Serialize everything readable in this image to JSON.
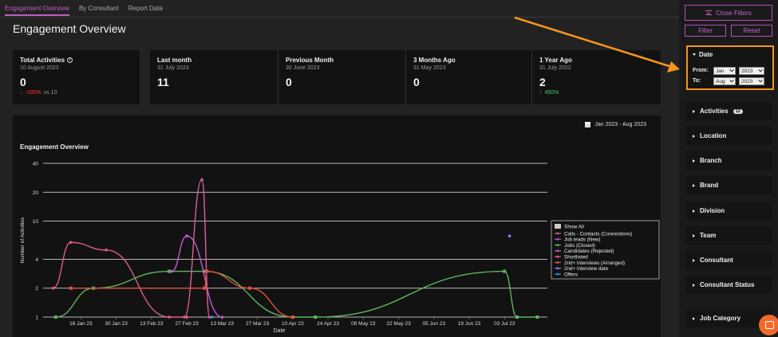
{
  "tabs": [
    {
      "label": "Engagement Overview",
      "active": true
    },
    {
      "label": "By Consultant",
      "active": false
    },
    {
      "label": "Report Data",
      "active": false
    }
  ],
  "page_title": "Engagement Overview",
  "kpis": {
    "total": {
      "label": "Total Activities",
      "date": "10 August 2023",
      "value": "0",
      "change": "-100%",
      "vs": "vs 10"
    },
    "last_month": {
      "label": "Last month",
      "date": "31 July 2023",
      "value": "11"
    },
    "previous_month": {
      "label": "Previous Month",
      "date": "30 June 2023",
      "value": "0"
    },
    "three_months": {
      "label": "3 Months Ago",
      "date": "31 May 2023",
      "value": "0"
    },
    "one_year": {
      "label": "1 Year Ago",
      "date": "31 July 2022",
      "value": "2",
      "change": "450%"
    }
  },
  "chart_card": {
    "date_range": "Jan 2023 - Aug 2023"
  },
  "chart_data": {
    "type": "line",
    "title": "Engagement Overview",
    "xlabel": "Date",
    "ylabel": "Number of Activities",
    "y_scale": "log",
    "ylim": [
      1,
      40
    ],
    "y_ticks": [
      "1",
      "2",
      "4",
      "10",
      "20",
      "40"
    ],
    "x_tick_labels": [
      "16 Jan 23",
      "30 Jan 23",
      "13 Feb 23",
      "27 Feb 23",
      "13 Mar 23",
      "27 Mar 23",
      "10 Apr 23",
      "24 Apr 23",
      "08 May 23",
      "22 May 23",
      "05 Jun 23",
      "19 Jun 23",
      "03 Jul 23"
    ],
    "legend_position": "right",
    "legend": {
      "show_all": "Show All",
      "items": [
        {
          "name": "Calls - Contacts (Connections)",
          "color": "#e05a8d"
        },
        {
          "name": "Job leads (New)",
          "color": "#b84cc4"
        },
        {
          "name": "Jobs (Closed)",
          "color": "#5db55d"
        },
        {
          "name": "Candidates (Rejected)",
          "color": "#c65ad0"
        },
        {
          "name": "Shortlisted",
          "color": "#d85f9e"
        },
        {
          "name": "2nd+ Interviews (Arranged)",
          "color": "#e0533c"
        },
        {
          "name": "2nd+ Interview date",
          "color": "#8a7cff"
        },
        {
          "name": "Offers",
          "color": "#3c8fd8"
        }
      ]
    },
    "series": [
      {
        "name": "Calls - Contacts (Connections)",
        "points": [
          [
            "2023-01-05",
            2
          ],
          [
            "2023-01-12",
            6
          ],
          [
            "2023-01-26",
            5
          ],
          [
            "2023-02-20",
            1
          ],
          [
            "2023-02-27",
            1
          ]
        ]
      },
      {
        "name": "Jobs (Closed)",
        "points": [
          [
            "2023-01-06",
            1
          ],
          [
            "2023-01-21",
            2
          ],
          [
            "2023-02-20",
            3
          ],
          [
            "2023-03-06",
            3
          ],
          [
            "2023-04-10",
            1
          ],
          [
            "2023-04-19",
            1
          ],
          [
            "2023-07-03",
            3
          ],
          [
            "2023-07-08",
            1
          ],
          [
            "2023-07-16",
            1
          ]
        ]
      },
      {
        "name": "Candidates (Rejected)",
        "points": [
          [
            "2023-02-21",
            3
          ],
          [
            "2023-02-27",
            7
          ],
          [
            "2023-03-13",
            1
          ]
        ]
      },
      {
        "name": "Shortlisted",
        "points": [
          [
            "2023-02-26",
            1
          ],
          [
            "2023-03-05",
            27
          ],
          [
            "2023-03-08",
            1
          ]
        ]
      },
      {
        "name": "2nd+ Interviews (Arranged)",
        "points": [
          [
            "2023-01-12",
            2
          ],
          [
            "2023-03-06",
            2
          ],
          [
            "2023-03-07",
            3
          ],
          [
            "2023-03-24",
            2
          ],
          [
            "2023-04-10",
            1
          ]
        ]
      },
      {
        "name": "2nd+ Interview date",
        "points": [
          [
            "2023-07-05",
            7
          ]
        ]
      },
      {
        "name": "Offers",
        "points": [
          [
            "2023-03-09",
            1
          ]
        ]
      }
    ]
  },
  "sidebar": {
    "close_filters": "Close Filters",
    "filter": "Filter",
    "reset": "Reset",
    "date": {
      "title": "Date",
      "from_label": "From:",
      "to_label": "To:",
      "from_month": "Jan",
      "from_year": "2023",
      "to_month": "Aug",
      "to_year": "2023"
    },
    "filters": [
      {
        "label": "Activities",
        "badge": "12"
      },
      {
        "label": "Location"
      },
      {
        "label": "Branch"
      },
      {
        "label": "Brand"
      },
      {
        "label": "Division"
      },
      {
        "label": "Team"
      },
      {
        "label": "Consultant"
      },
      {
        "label": "Consultant Status"
      },
      {
        "label": "Job Category"
      }
    ]
  },
  "colors": {
    "accent": "#c05cc5",
    "highlight": "#f7941d",
    "up": "#3fce5f",
    "down": "#ff3b3b"
  }
}
